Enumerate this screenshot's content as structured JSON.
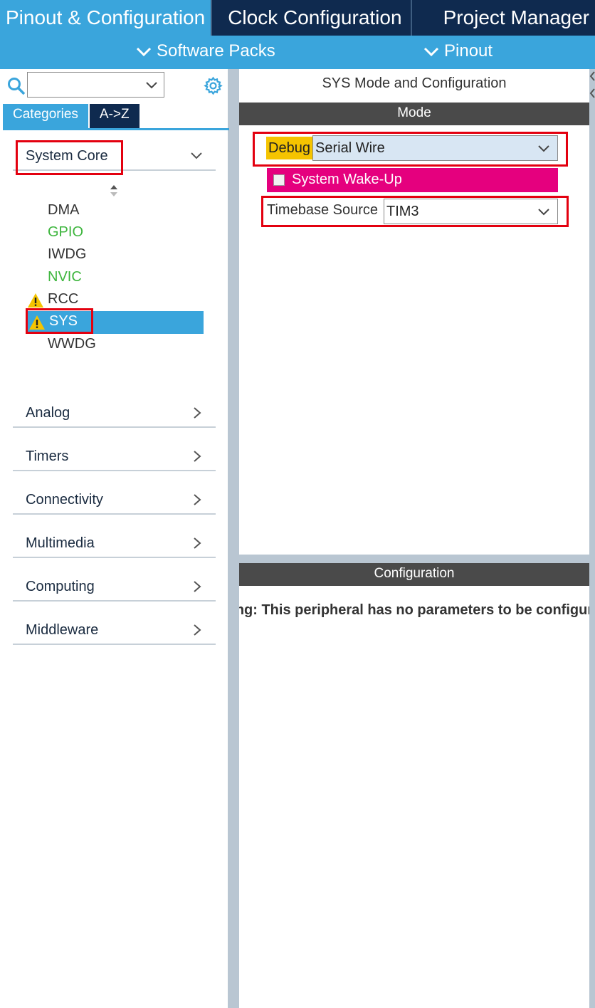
{
  "tabs": {
    "pinout": "Pinout & Configuration",
    "clock": "Clock Configuration",
    "project": "Project Manager"
  },
  "subbar": {
    "software_packs": "Software Packs",
    "pinout": "Pinout"
  },
  "sidebar": {
    "search_placeholder": "",
    "tab_categories": "Categories",
    "tab_az": "A->Z",
    "system_core": "System Core",
    "peripherals": [
      {
        "label": "DMA",
        "status": "none"
      },
      {
        "label": "GPIO",
        "status": "configured"
      },
      {
        "label": "IWDG",
        "status": "none"
      },
      {
        "label": "NVIC",
        "status": "configured"
      },
      {
        "label": "RCC",
        "status": "warning"
      },
      {
        "label": "SYS",
        "status": "warning-selected"
      },
      {
        "label": "WWDG",
        "status": "none"
      }
    ],
    "groups": [
      "Analog",
      "Timers",
      "Connectivity",
      "Multimedia",
      "Computing",
      "Middleware"
    ]
  },
  "main": {
    "title": "SYS Mode and Configuration",
    "mode_header": "Mode",
    "debug_label": "Debug",
    "debug_value": "Serial Wire",
    "wakeup_label": "System Wake-Up",
    "timebase_label": "Timebase Source",
    "timebase_value": "TIM3",
    "config_header": "Configuration",
    "config_warning": "Warning: This peripheral has no parameters to be configured."
  },
  "colors": {
    "accent": "#3aa5dc",
    "navy": "#0f2a4f",
    "highlight_red": "#e3000f",
    "debug_yellow": "#f5c400",
    "wakeup_magenta": "#e5007e",
    "configured_green": "#3db53d"
  }
}
